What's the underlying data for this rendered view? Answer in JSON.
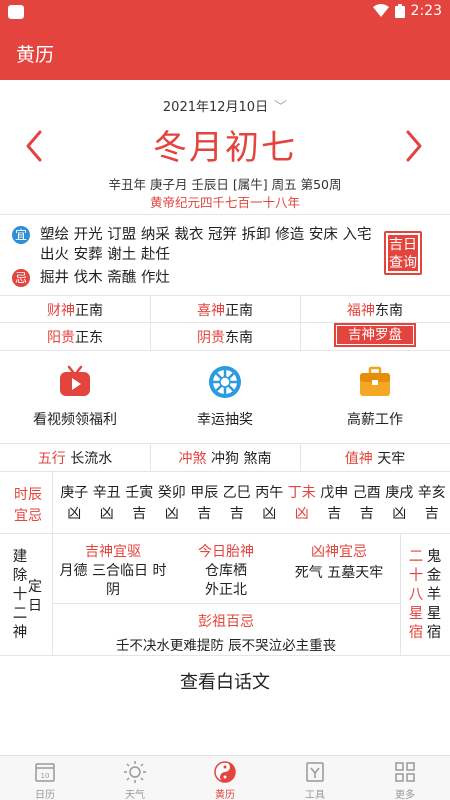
{
  "status": {
    "time": "2:23"
  },
  "appbar": {
    "title": "黄历"
  },
  "date": {
    "gregorian": "2021年12月10日",
    "lunar": "冬月初七",
    "ganzhi": "辛丑年 庚子月 壬辰日 [属牛] 周五 第50周",
    "huangdi": "黄帝纪元四千七百一十八年"
  },
  "yiji": {
    "yi_badge": "宜",
    "yi_text": "塑绘 开光 订盟 纳采 裁衣 冠笄 拆卸 修造 安床 入宅 出火 安葬 谢土 赴任",
    "ji_badge": "忌",
    "ji_text": "掘井 伐木 斋醮 作灶",
    "jiri_button": [
      "吉日",
      "查询"
    ]
  },
  "gods": {
    "caishen_label": "财神",
    "caishen_value": "正南",
    "xishen_label": "喜神",
    "xishen_value": "正南",
    "fushen_label": "福神",
    "fushen_value": "东南",
    "yanggui_label": "阳贵",
    "yanggui_value": "正东",
    "yingui_label": "阴贵",
    "yingui_value": "东南",
    "luopan_button": "吉神罗盘"
  },
  "features": {
    "video": "看视频领福利",
    "lottery": "幸运抽奖",
    "job": "高薪工作"
  },
  "wuxing": {
    "wuxing_label": "五行",
    "wuxing_value": "长流水",
    "chongsha_label": "冲煞",
    "chongsha_value": "冲狗 煞南",
    "zhishen_label": "值神",
    "zhishen_value": "天牢"
  },
  "shichen": {
    "label_top": "时辰",
    "label_bottom": "宜忌",
    "hours": [
      {
        "name": "庚子",
        "luck": "凶",
        "highlight": false
      },
      {
        "name": "辛丑",
        "luck": "凶",
        "highlight": false
      },
      {
        "name": "壬寅",
        "luck": "吉",
        "highlight": false
      },
      {
        "name": "癸卯",
        "luck": "凶",
        "highlight": false
      },
      {
        "name": "甲辰",
        "luck": "吉",
        "highlight": false
      },
      {
        "name": "乙巳",
        "luck": "吉",
        "highlight": false
      },
      {
        "name": "丙午",
        "luck": "凶",
        "highlight": false
      },
      {
        "name": "丁未",
        "luck": "凶",
        "highlight": true
      },
      {
        "name": "戊申",
        "luck": "吉",
        "highlight": false
      },
      {
        "name": "己酉",
        "luck": "吉",
        "highlight": false
      },
      {
        "name": "庚戌",
        "luck": "凶",
        "highlight": false
      },
      {
        "name": "辛亥",
        "luck": "吉",
        "highlight": false
      }
    ]
  },
  "bottom": {
    "jianchu_label": "建除十二神",
    "jianchu_value": "定日",
    "jishen_label": "吉神宜驱",
    "jishen_line1": "月德 三合临日 时",
    "jishen_line2": "阴",
    "taishen_label": "今日胎神",
    "taishen_line1": "仓库栖",
    "taishen_line2": "外正北",
    "xiongshen_label": "凶神宜忌",
    "xiongshen_value": "死气 五墓天牢",
    "xiu_label": "二十八星宿",
    "xiu_value": "鬼金羊星宿",
    "pengzu_label": "彭祖百忌",
    "pengzu_value": "壬不决水更难提防 辰不哭泣必主重丧"
  },
  "baihuawen": "查看白话文",
  "tabs": [
    {
      "label": "日历",
      "icon": "calendar-icon",
      "active": false
    },
    {
      "label": "天气",
      "icon": "sun-icon",
      "active": false
    },
    {
      "label": "黄历",
      "icon": "yinyang-icon",
      "active": true
    },
    {
      "label": "工具",
      "icon": "tools-icon",
      "active": false
    },
    {
      "label": "更多",
      "icon": "grid-icon",
      "active": false
    }
  ],
  "colors": {
    "accent": "#e4443e",
    "badge_yi": "#2f8fd6",
    "badge_ji": "#e4443e"
  }
}
